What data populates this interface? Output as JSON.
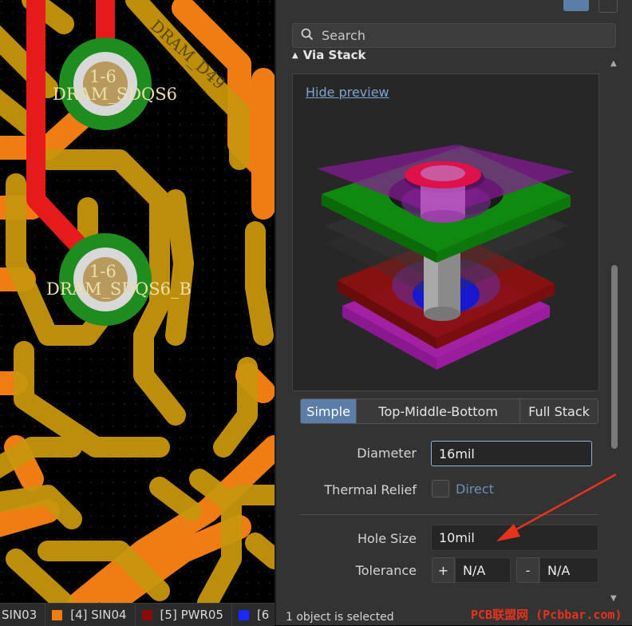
{
  "pcb": {
    "pads": [
      {
        "number": "1-6",
        "net": "DRAM_SDQS6"
      },
      {
        "number": "1-6",
        "net": "DRAM_SDQS6_B"
      }
    ],
    "track_label": "DRAM_D49",
    "colors": {
      "top_copper": "#e61a1a",
      "mid_layer": "#c8960c",
      "orange_layer": "#f07d14",
      "pad_ring": "#1e8c1e",
      "pad_center": "#d8d8d8"
    }
  },
  "layer_tabs": [
    {
      "label": "SIN03",
      "color": ""
    },
    {
      "label": "[4] SIN04",
      "color": "#f07d14"
    },
    {
      "label": "[5] PWR05",
      "color": "#8b0a0a"
    },
    {
      "label": "[6",
      "color": "#1a2aff"
    }
  ],
  "panel": {
    "search": {
      "placeholder": "Search",
      "icon": "search-icon"
    },
    "section_title": "Via Stack",
    "hide_preview": "Hide preview",
    "stack_modes": [
      {
        "label": "Simple",
        "active": true
      },
      {
        "label": "Top-Middle-Bottom",
        "active": false
      },
      {
        "label": "Full Stack",
        "active": false
      }
    ],
    "diameter": {
      "label": "Diameter",
      "value": "16mil"
    },
    "thermal_relief": {
      "label": "Thermal Relief",
      "option": "Direct",
      "checked": false
    },
    "hole_size": {
      "label": "Hole Size",
      "value": "10mil"
    },
    "tolerance": {
      "label": "Tolerance",
      "plus_label": "+",
      "plus_value": "N/A",
      "minus_label": "-",
      "minus_value": "N/A"
    }
  },
  "status": {
    "selection_text": "1 object is selected"
  },
  "watermark": "PCB联盟网 (Pcbbar.com)"
}
